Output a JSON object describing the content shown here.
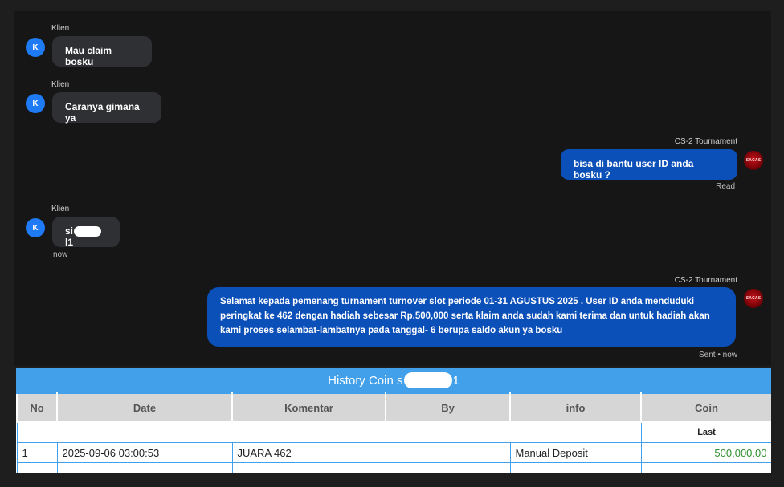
{
  "chat": {
    "messages": [
      {
        "sender": "Klien",
        "avatar": "K",
        "text": "Mau claim bosku"
      },
      {
        "sender": "Klien",
        "avatar": "K",
        "text": "Caranya gimana ya"
      },
      {
        "sender": "CS-2 Tournament",
        "text": "bisa di bantu user ID anda bosku ?",
        "status": "Read"
      },
      {
        "sender": "Klien",
        "avatar": "K",
        "text_prefix": "si",
        "text_suffix": "l1",
        "status": "now"
      },
      {
        "sender": "CS-2 Tournament",
        "text": "Selamat kepada pemenang turnament turnover slot periode 01-31 AGUSTUS 2025 . User ID anda menduduki peringkat ke 462 dengan hadiah sebesar Rp.500,000 serta klaim anda sudah kami terima dan untuk hadiah akan kami proses selambat-lambatnya pada tanggal- 6 berupa saldo akun ya bosku",
        "status": "Sent • now"
      }
    ],
    "cs_avatar_label": "SACAS"
  },
  "history": {
    "title_prefix": "History Coin s",
    "title_suffix": "1",
    "columns": [
      "No",
      "Date",
      "Komentar",
      "By",
      "info",
      "Coin"
    ],
    "last_label": "Last",
    "rows": [
      {
        "no": "1",
        "date": "2025-09-06 03:00:53",
        "komentar": "JUARA 462",
        "by": "",
        "info": "Manual Deposit",
        "coin": "500,000.00"
      }
    ]
  },
  "colors": {
    "accent": "#42a0ea",
    "bubble_out": "#0b4fb8",
    "bubble_in": "#2f3033",
    "coin_green": "#2f8f2f"
  }
}
